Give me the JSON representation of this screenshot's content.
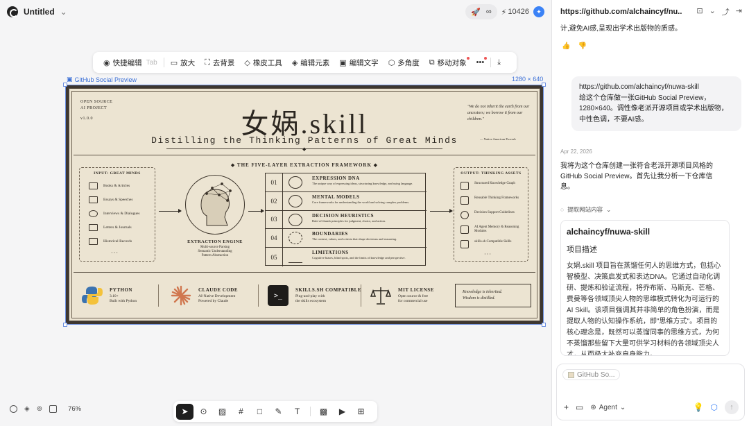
{
  "topbar": {
    "doc_title": "Untitled",
    "credits": "10426",
    "pill_right": "∞"
  },
  "toolbar": {
    "items": [
      {
        "label": "快捷编辑",
        "hint": "Tab",
        "icon": "quick-edit-icon"
      },
      {
        "label": "放大",
        "icon": "upscale-hd-icon"
      },
      {
        "label": "去背景",
        "icon": "remove-bg-icon"
      },
      {
        "label": "橡皮工具",
        "icon": "eraser-icon"
      },
      {
        "label": "编辑元素",
        "icon": "layers-icon"
      },
      {
        "label": "编辑文字",
        "icon": "edit-text-icon"
      },
      {
        "label": "多角度",
        "icon": "cube-icon"
      },
      {
        "label": "移动对象",
        "icon": "move-object-icon"
      }
    ]
  },
  "frame": {
    "label": "GitHub Social Preview",
    "size": "1280 × 640"
  },
  "poster": {
    "top_left": [
      "OPEN SOURCE",
      "AI PROJECT",
      "v1.0.0"
    ],
    "title": "女娲.skill",
    "subtitle": "Distilling the Thinking Patterns of Great Minds",
    "quote": "\"We do not inherit the earth from our ancestors; we borrow it from our children.\"",
    "quote_source": "— Native American Proverb",
    "framework_title": "◆ THE FIVE-LAYER EXTRACTION FRAMEWORK ◆",
    "input_head": "INPUT: GREAT MINDS",
    "inputs": [
      "Books & Articles",
      "Essays & Speeches",
      "Interviews & Dialogues",
      "Letters & Journals",
      "Historical Records"
    ],
    "engine_title": "EXTRACTION ENGINE",
    "engine_sub": [
      "Multi-source Parsing",
      "Semantic Understanding",
      "Pattern Abstraction"
    ],
    "layers": [
      {
        "num": "01",
        "title": "EXPRESSION DNA",
        "desc": "The unique way of expressing ideas, structuring knowledge, and using language."
      },
      {
        "num": "02",
        "title": "MENTAL MODELS",
        "desc": "Core frameworks for understanding the world and solving complex problems."
      },
      {
        "num": "03",
        "title": "DECISION HEURISTICS",
        "desc": "Rule-of-thumb principles for judgment, choice, and action."
      },
      {
        "num": "04",
        "title": "BOUNDARIES",
        "desc": "The context, values, and criteria that shape decisions and reasoning."
      },
      {
        "num": "05",
        "title": "LIMITATIONS",
        "desc": "Cognitive biases, blind spots, and the limits of knowledge and perspective."
      }
    ],
    "output_head": "OUTPUT: THINKING ASSETS",
    "outputs": [
      "Structured Knowledge Graph",
      "Reusable Thinking Frameworks",
      "Decision Support Guidelines",
      "AI Agent Memory & Reasoning Modules",
      "skills.sh Compatible Skills"
    ],
    "footer": [
      {
        "title": "PYTHON",
        "desc": [
          "3.10+",
          "Built with Python"
        ]
      },
      {
        "title": "CLAUDE CODE",
        "desc": [
          "AI-Native Development",
          "Powered by Claude"
        ]
      },
      {
        "title": "SKILLS.SH COMPATIBLE",
        "desc": [
          "Plug-and-play with",
          "the skills ecosystem"
        ]
      },
      {
        "title": "MIT LICENSE",
        "desc": [
          "Open source & free",
          "for commercial use"
        ]
      }
    ],
    "motto": [
      "Knowledge is inherited.",
      "Wisdom is distilled."
    ]
  },
  "bottom": {
    "zoom": "76%"
  },
  "panel": {
    "url": "https://github.com/alchaincyf/nu...",
    "prev_msg": "计,避免AI感,呈现出学术出版物的质感。",
    "user_msg": [
      "https://github.com/alchaincyf/nuwa-skill",
      "给这个仓库做一张GitHub Social Preview，",
      "1280×640。调性像老派开源项目或学术出版物，",
      "中性色调，不要AI感。"
    ],
    "date": "Apr 22, 2026",
    "assistant_msg": [
      "我将为这个仓库创建一张符合老派开源项目风格的",
      "GitHub Social Preview。首先让我分析一下仓库信",
      "息。"
    ],
    "tool_call": "提取网站内容",
    "card_title": "alchaincyf/nuwa-skill",
    "card_sub": "项目描述",
    "card_body": "女娲.skill 项目旨在蒸馏任何人的思维方式，包括心智模型、决策启发式和表达DNA。它通过自动化调研、提炼和验证流程，将乔布斯、马斯克、芒格、费曼等各领域顶尖人物的思维模式转化为可运行的AI Skill。该项目强调其并非简单的角色扮演，而是提取人物的认知操作系统，即\"思维方式\"。项目的核心理念是，既然可以蒸馏同事的思维方式，为何不蒸馏那些留下大量可供学习材料的各领域顶尖人才，从而极大补充自身能力。...",
    "chip": "GitHub So...",
    "agent_label": "Agent"
  }
}
